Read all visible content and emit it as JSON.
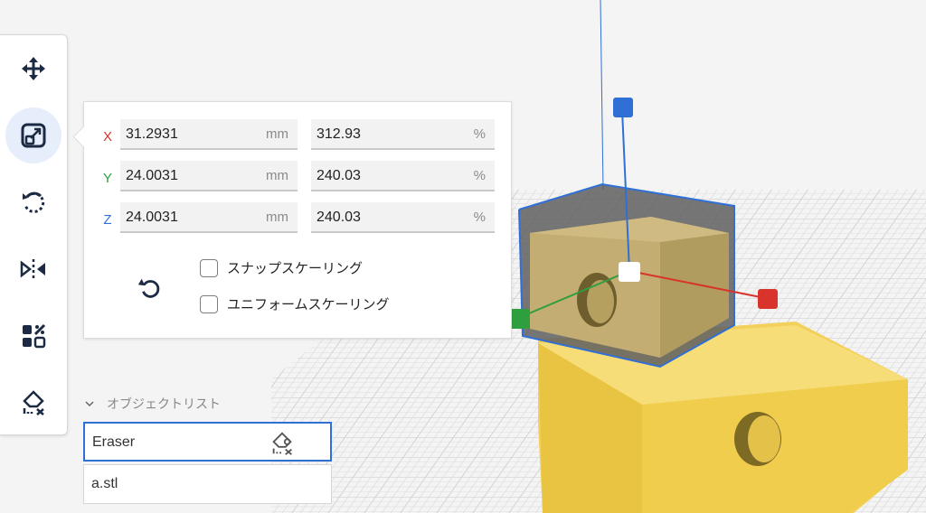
{
  "toolbar": {
    "tools": [
      {
        "name": "move",
        "icon": "move-icon",
        "active": false
      },
      {
        "name": "scale",
        "icon": "scale-icon",
        "active": true
      },
      {
        "name": "rotate",
        "icon": "rotate-icon",
        "active": false
      },
      {
        "name": "mirror",
        "icon": "mirror-icon",
        "active": false
      },
      {
        "name": "arrange",
        "icon": "arrange-icon",
        "active": false
      },
      {
        "name": "eraser",
        "icon": "eraser-icon",
        "active": false
      }
    ]
  },
  "scale_panel": {
    "rows": [
      {
        "axis": "X",
        "axis_color": "#d9342b",
        "value": "31.2931",
        "unit": "mm",
        "percent": "312.93",
        "percent_unit": "%"
      },
      {
        "axis": "Y",
        "axis_color": "#2e9e3f",
        "value": "24.0031",
        "unit": "mm",
        "percent": "240.03",
        "percent_unit": "%"
      },
      {
        "axis": "Z",
        "axis_color": "#2f6fd6",
        "value": "24.0031",
        "unit": "mm",
        "percent": "240.03",
        "percent_unit": "%"
      }
    ],
    "snap_scaling": {
      "label": "スナップスケーリング",
      "checked": false
    },
    "uniform_scaling": {
      "label": "ユニフォームスケーリング",
      "checked": false
    },
    "reset_icon": "reset-icon"
  },
  "object_list": {
    "header": "オブジェクトリスト",
    "items": [
      {
        "name": "Eraser",
        "selected": true,
        "icon": "eraser-icon"
      },
      {
        "name": "a.stl",
        "selected": false
      }
    ]
  },
  "colors": {
    "accent": "#2f6fd6",
    "model_yellow": "#f5d65e",
    "x_axis": "#d9342b",
    "y_axis": "#2e9e3f",
    "z_axis": "#2f6fd6"
  }
}
